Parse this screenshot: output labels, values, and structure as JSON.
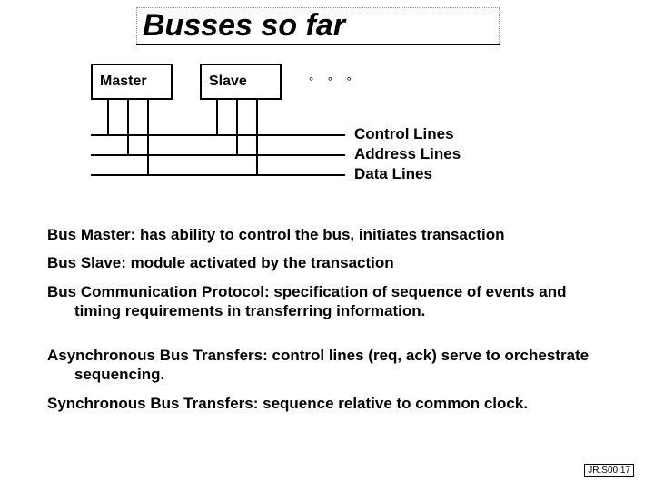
{
  "title": "Busses so far",
  "diagram": {
    "master_label": "Master",
    "slave_label": "Slave",
    "ellipsis": "° ° °",
    "bus_labels": {
      "control": "Control Lines",
      "address": "Address Lines",
      "data": "Data Lines"
    }
  },
  "definitions": {
    "bus_master": "Bus Master:  has ability to control the bus, initiates transaction",
    "bus_slave": "Bus Slave:  module activated by the transaction",
    "bus_protocol": "Bus Communication Protocol:  specification of sequence of events and timing requirements in transferring information.",
    "async": "Asynchronous Bus Transfers:  control lines (req, ack) serve to orchestrate sequencing.",
    "sync": "Synchronous Bus Transfers:  sequence relative to common clock."
  },
  "footer": "JR.S00 17"
}
